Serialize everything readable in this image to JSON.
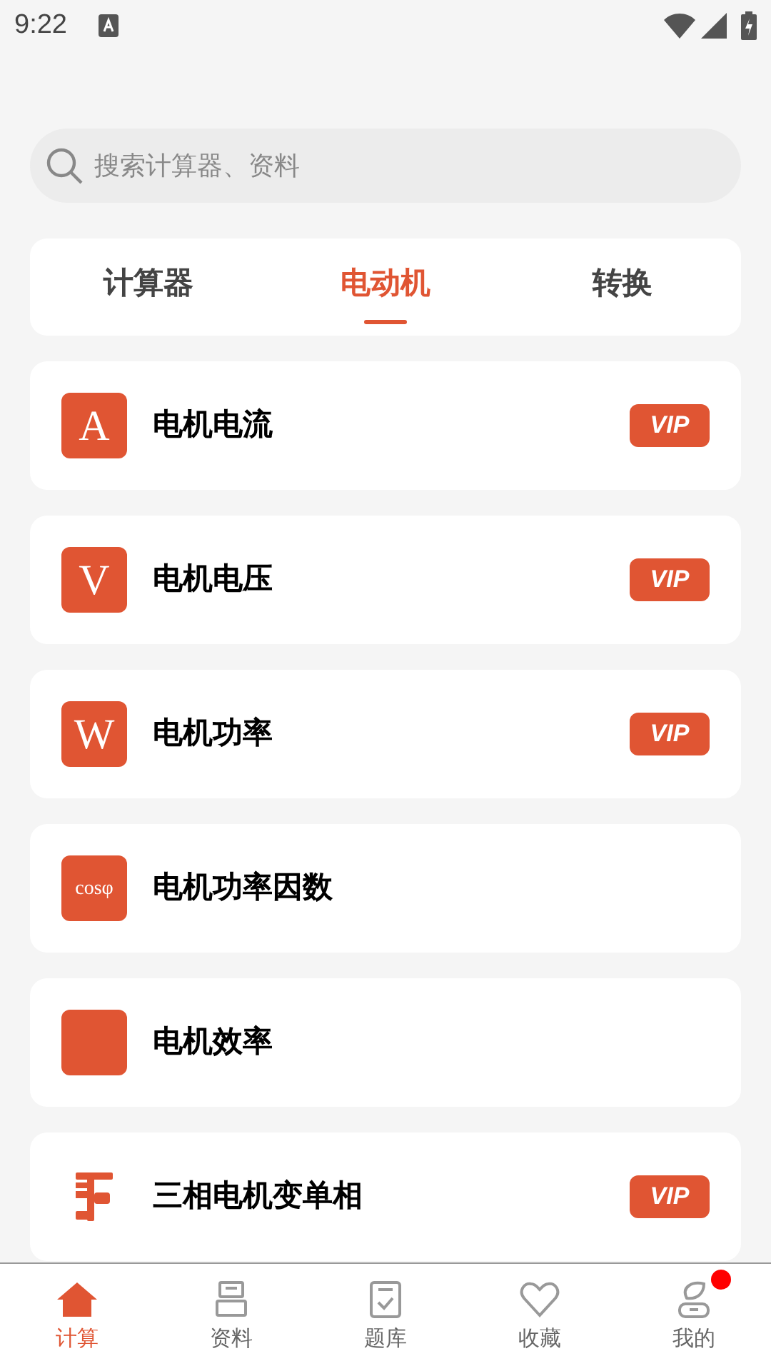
{
  "status_bar": {
    "time": "9:22"
  },
  "search": {
    "placeholder": "搜索计算器、资料"
  },
  "tabs": [
    {
      "label": "计算器",
      "selected": false
    },
    {
      "label": "电动机",
      "selected": true
    },
    {
      "label": "转换",
      "selected": false
    }
  ],
  "items": [
    {
      "title": "电机电流",
      "icon": {
        "kind": "letter",
        "text": "A"
      },
      "badge": "VIP"
    },
    {
      "title": "电机电压",
      "icon": {
        "kind": "letter",
        "text": "V"
      },
      "badge": "VIP"
    },
    {
      "title": "电机功率",
      "icon": {
        "kind": "letter",
        "text": "W"
      },
      "badge": "VIP"
    },
    {
      "title": "电机功率因数",
      "icon": {
        "kind": "small_letter",
        "text": "cosφ"
      }
    },
    {
      "title": "电机效率",
      "icon": {
        "kind": "blank"
      }
    },
    {
      "title": "三相电机变单相",
      "icon": {
        "kind": "circuit"
      },
      "badge": "VIP"
    }
  ],
  "nav": [
    {
      "label": "计算",
      "kind": "home",
      "selected": true,
      "dot": false
    },
    {
      "label": "资料",
      "kind": "stack",
      "selected": false,
      "dot": false
    },
    {
      "label": "题库",
      "kind": "check",
      "selected": false,
      "dot": false
    },
    {
      "label": "收藏",
      "kind": "heart",
      "selected": false,
      "dot": false
    },
    {
      "label": "我的",
      "kind": "user",
      "selected": false,
      "dot": true
    }
  ]
}
